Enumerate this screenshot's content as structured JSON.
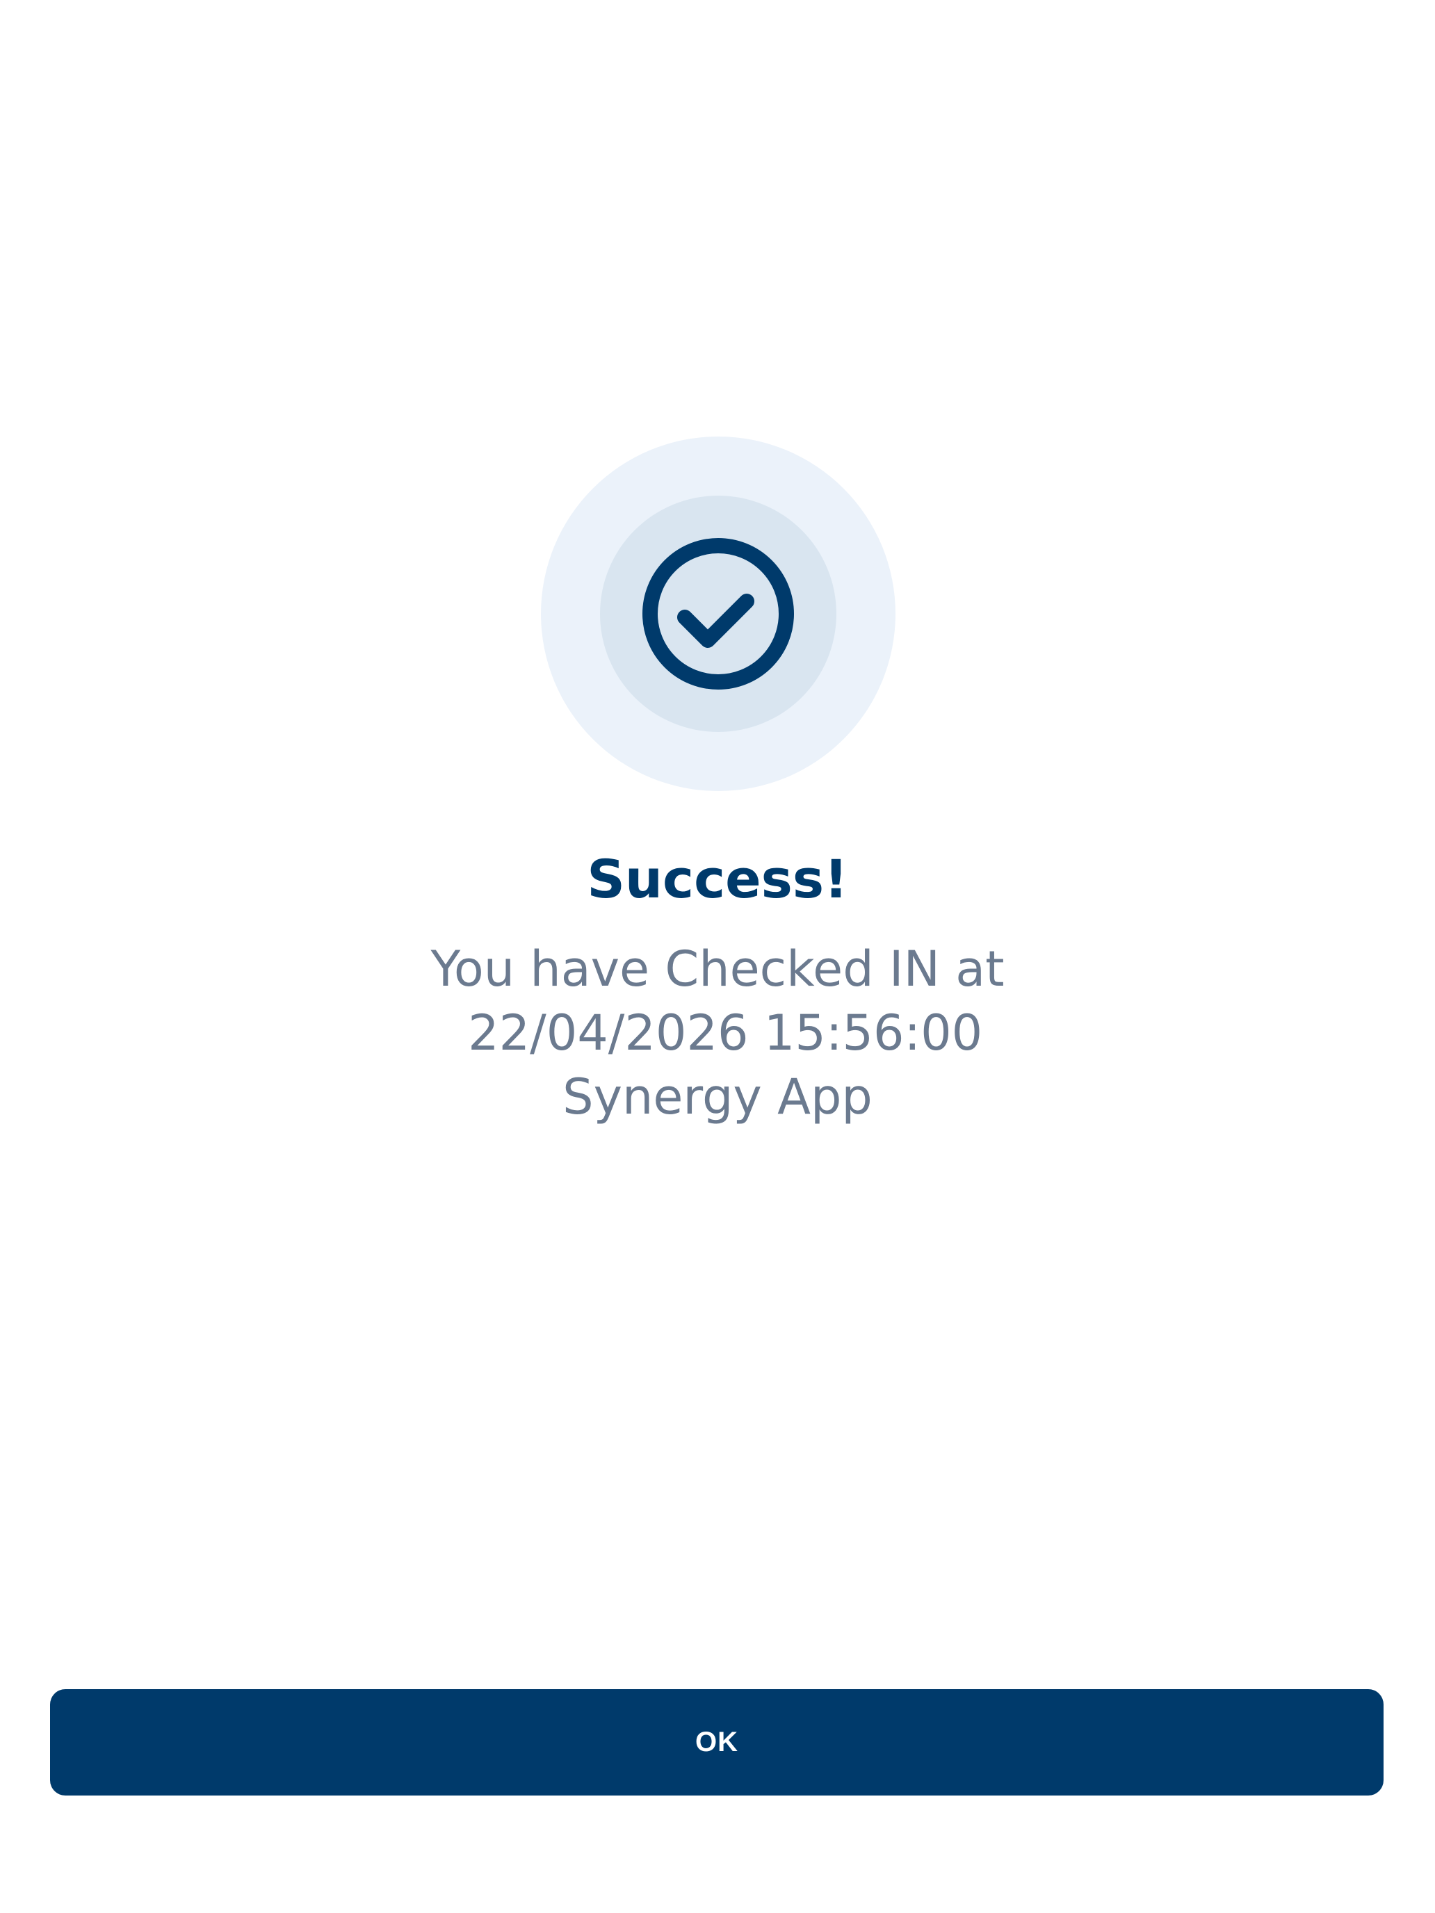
{
  "dialog": {
    "icon": "check-circle-icon",
    "title": "Success!",
    "message_lines": [
      "You have Checked IN at",
      " 22/04/2026 15:56:00",
      "Synergy App"
    ],
    "ok_label": "OK"
  },
  "colors": {
    "primary": "#003a6b",
    "icon_ring_outer": "#ebf2fa",
    "icon_ring_inner": "#d9e5f0",
    "message_text": "#6b7a8f",
    "background": "#ffffff"
  }
}
